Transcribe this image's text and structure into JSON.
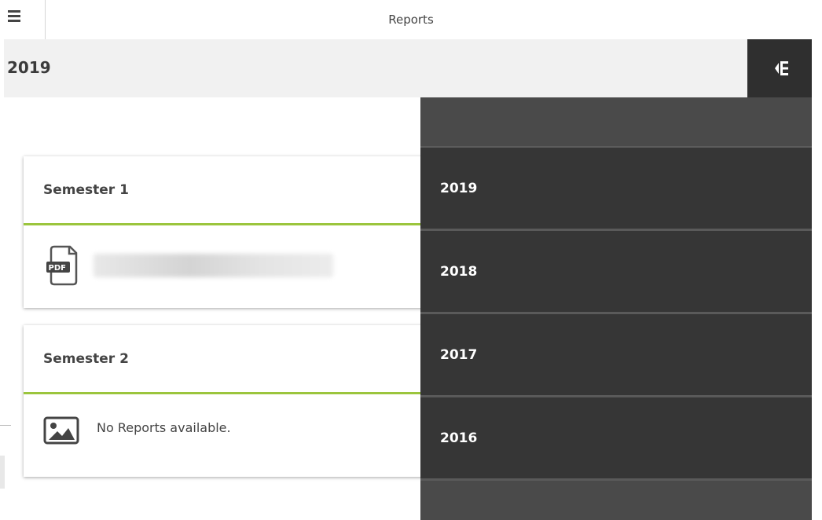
{
  "app": {
    "title": "Reports"
  },
  "header": {
    "selected_year": "2019"
  },
  "semesters": [
    {
      "title": "Semester 1",
      "report_icon": "pdf-icon"
    },
    {
      "title": "Semester 2",
      "empty_icon": "image-icon",
      "empty_text": "No Reports available."
    }
  ],
  "drawer": {
    "years": [
      "2019",
      "2018",
      "2017",
      "2016"
    ]
  },
  "colors": {
    "accent": "#9bc53d",
    "drawer_bg": "#363636",
    "drawer_panel": "#4a4a4a",
    "header_bg": "#f1f1f1"
  }
}
